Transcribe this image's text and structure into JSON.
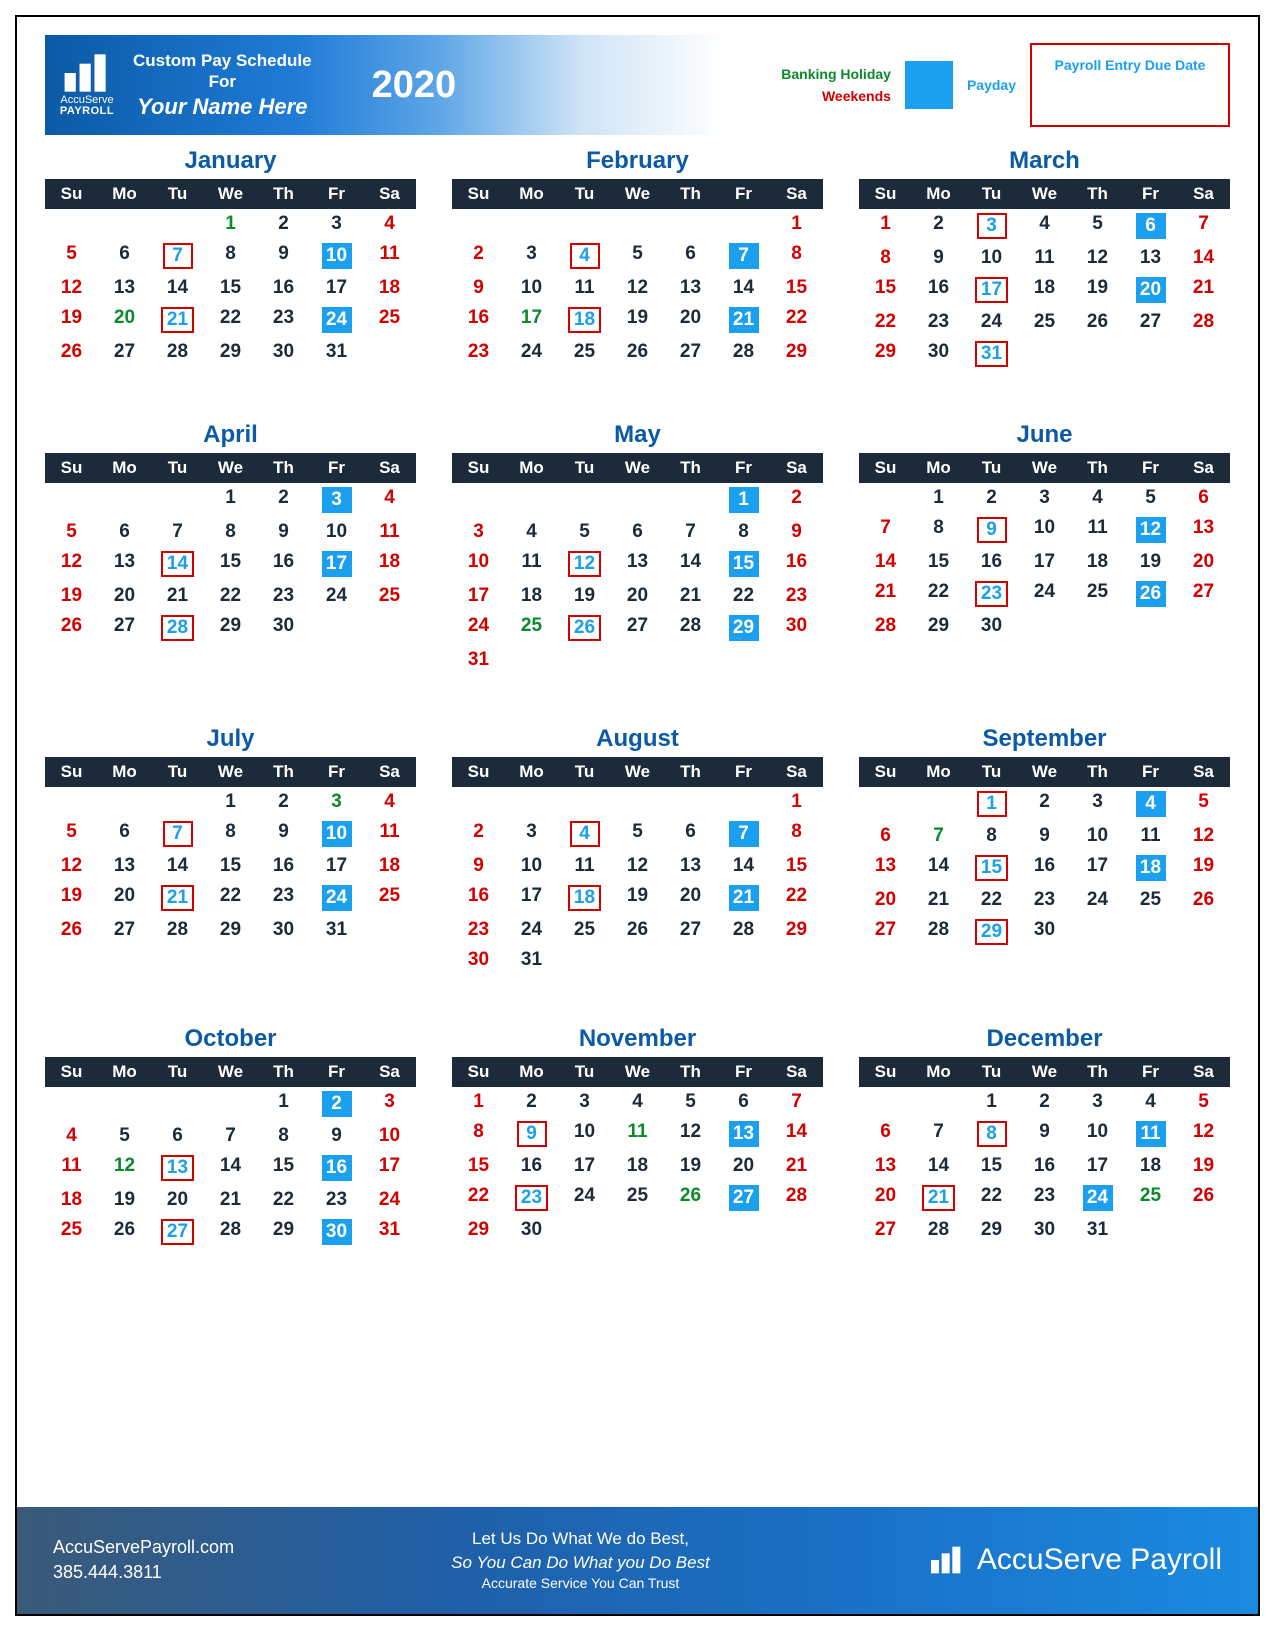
{
  "header": {
    "logo_top": "AccuServe",
    "logo_bot": "PAYROLL",
    "sched_l1": "Custom Pay Schedule",
    "sched_l2": "For",
    "sched_l3": "Your Name Here",
    "year": "2020",
    "leg_holiday": "Banking Holiday",
    "leg_weekend": "Weekends",
    "leg_payday": "Payday",
    "leg_entry": "Payroll Entry Due Date"
  },
  "dow": [
    "Su",
    "Mo",
    "Tu",
    "We",
    "Th",
    "Fr",
    "Sa"
  ],
  "months": [
    {
      "name": "January",
      "offset": 3,
      "days": 31,
      "holidays": [
        1,
        20
      ],
      "paydays": [
        10,
        24
      ],
      "entries": [
        7,
        21
      ]
    },
    {
      "name": "February",
      "offset": 6,
      "days": 29,
      "holidays": [
        17
      ],
      "paydays": [
        7,
        21
      ],
      "entries": [
        4,
        18
      ]
    },
    {
      "name": "March",
      "offset": 0,
      "days": 31,
      "holidays": [],
      "paydays": [
        6,
        20
      ],
      "entries": [
        3,
        17,
        31
      ]
    },
    {
      "name": "April",
      "offset": 3,
      "days": 30,
      "holidays": [],
      "paydays": [
        3,
        17
      ],
      "entries": [
        14,
        28
      ]
    },
    {
      "name": "May",
      "offset": 5,
      "days": 31,
      "holidays": [
        25
      ],
      "paydays": [
        1,
        15,
        29
      ],
      "entries": [
        12,
        26
      ]
    },
    {
      "name": "June",
      "offset": 1,
      "days": 30,
      "holidays": [],
      "paydays": [
        12,
        26
      ],
      "entries": [
        9,
        23
      ]
    },
    {
      "name": "July",
      "offset": 3,
      "days": 31,
      "holidays": [
        3
      ],
      "paydays": [
        10,
        24
      ],
      "entries": [
        7,
        21
      ]
    },
    {
      "name": "August",
      "offset": 6,
      "days": 31,
      "holidays": [],
      "paydays": [
        7,
        21
      ],
      "entries": [
        4,
        18
      ]
    },
    {
      "name": "September",
      "offset": 2,
      "days": 30,
      "holidays": [
        7
      ],
      "paydays": [
        4,
        18
      ],
      "entries": [
        1,
        15,
        29
      ]
    },
    {
      "name": "October",
      "offset": 4,
      "days": 31,
      "holidays": [
        12
      ],
      "paydays": [
        2,
        16,
        30
      ],
      "entries": [
        13,
        27
      ]
    },
    {
      "name": "November",
      "offset": 0,
      "days": 30,
      "holidays": [
        11,
        26
      ],
      "paydays": [
        13,
        27
      ],
      "entries": [
        9,
        23
      ]
    },
    {
      "name": "December",
      "offset": 2,
      "days": 31,
      "holidays": [
        25
      ],
      "paydays": [
        11,
        24
      ],
      "entries": [
        8,
        21
      ]
    }
  ],
  "footer": {
    "url": "AccuServePayroll.com",
    "phone": "385.444.3811",
    "l1": "Let Us Do What We do Best,",
    "l2": "So You Can Do What you Do Best",
    "l3": "Accurate Service You Can Trust",
    "brand": "AccuServe Payroll"
  }
}
